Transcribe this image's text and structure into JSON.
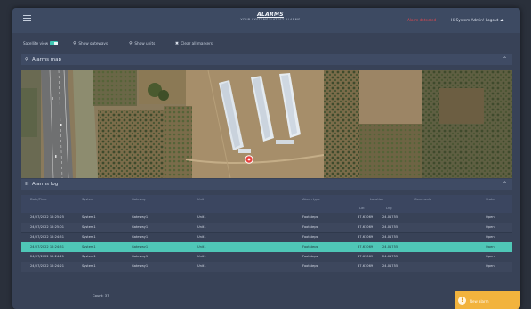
{
  "header": {
    "title": "ALARMS",
    "subtitle": "YOUR SYSTEMS' LATEST ALARMS",
    "alert_text": "Alarm detected",
    "user_text": "Hi System Admin! Logout"
  },
  "toolbar": {
    "satellite_label": "Satellite view",
    "satellite_on": true,
    "gateways_label": "Show gateways",
    "units_label": "Show units",
    "clear_label": "Clear all markers"
  },
  "map_section": {
    "title": "Alarms map"
  },
  "log_section": {
    "title": "Alarms log"
  },
  "table": {
    "columns": [
      "Date/Time",
      "System",
      "Gateway",
      "Unit",
      "Alarm type",
      "Location",
      "Comments",
      "Status"
    ],
    "location_sub": [
      "Lat",
      "Lng"
    ],
    "rows": [
      [
        "24/07/2022 12:25:25",
        "System1",
        "Gateway1",
        "Unit1",
        "Footsteps",
        "37.61069",
        "24.01755",
        "",
        "Open"
      ],
      [
        "24/07/2022 12:25:01",
        "System1",
        "Gateway1",
        "Unit1",
        "Footsteps",
        "37.61069",
        "24.01755",
        "",
        "Open"
      ],
      [
        "24/07/2022 12:24:51",
        "System1",
        "Gateway1",
        "Unit1",
        "Footsteps",
        "37.61069",
        "24.01755",
        "",
        "Open"
      ],
      [
        "24/07/2022 12:24:51",
        "System1",
        "Gateway1",
        "Unit1",
        "Footsteps",
        "37.61069",
        "24.01755",
        "",
        "Open"
      ],
      [
        "24/07/2022 12:24:21",
        "System1",
        "Gateway1",
        "Unit1",
        "Footsteps",
        "37.61069",
        "24.01755",
        "",
        "Open"
      ],
      [
        "24/07/2022 12:24:21",
        "System1",
        "Gateway1",
        "Unit1",
        "Footsteps",
        "37.61069",
        "24.01755",
        "",
        "Open"
      ]
    ],
    "selected_row": 3,
    "count_label": "Count: 37"
  },
  "toast": {
    "text": "New alarm"
  },
  "colors": {
    "accent": "#4fc7b7",
    "alert": "#e0484f",
    "toast": "#f2b33d"
  }
}
